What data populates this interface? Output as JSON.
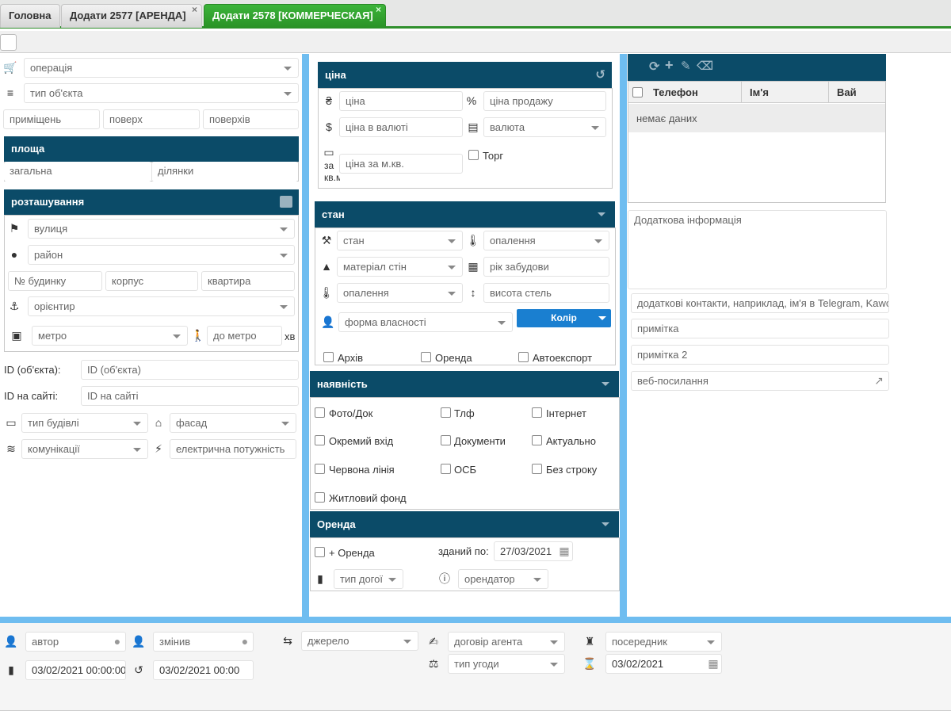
{
  "tabs": [
    {
      "label": "Головна"
    },
    {
      "label": "Додати 2577 [АРЕНДА]"
    },
    {
      "label": "Додати 2578 [КОММЕРЧЕСКАЯ]"
    }
  ],
  "tab_close": "×",
  "left": {
    "operation": "операція",
    "object_type": "тип об'єкта",
    "rooms": "приміщень",
    "floor": "поверх",
    "floors": "поверхів",
    "area_header": "площа",
    "area_total": "загальна",
    "area_plot": "ділянки",
    "location_header": "розташування",
    "street": "вулиця",
    "district": "район",
    "house_no": "№ будинку",
    "building": "корпус",
    "apartment": "квартира",
    "landmark": "орієнтир",
    "metro": "метро",
    "to_metro": "до метро",
    "minutes": "хв",
    "id_object_label": "ID (об'єкта):",
    "id_object_ph": "ID (об'єкта)",
    "id_site_label": "ID на сайті:",
    "id_site_ph": "ID на сайті",
    "building_type": "тип будівлі",
    "facade": "фасад",
    "communications": "комунікації",
    "power": "електрична потужність"
  },
  "price": {
    "header": "ціна",
    "price": "ціна",
    "sale_price": "ціна продажу",
    "price_currency": "ціна в валюті",
    "currency": "валюта",
    "per_sqm_label": "за кв.м",
    "per_sqm": "ціна за м.кв.",
    "bargain": "Торг"
  },
  "state": {
    "header": "стан",
    "state": "стан",
    "heating": "опалення",
    "wall_material": "матеріал стін",
    "year_built": "рік забудови",
    "heating2": "опалення",
    "ceiling_height": "висота стель",
    "ownership": "форма власності",
    "color_btn": "Колір",
    "archive": "Архів",
    "rent": "Оренда",
    "autoexport": "Автоекспорт"
  },
  "availability": {
    "header": "наявність",
    "items": [
      "Фото/Док",
      "Тлф",
      "Інтернет",
      "Окремий вхід",
      "Документи",
      "Актуально",
      "Червона лінія",
      "ОСБ",
      "Без строку",
      "Житловий фонд"
    ]
  },
  "rent": {
    "header": "Оренда",
    "plus_rent": "+ Оренда",
    "rented_until_label": "зданий по:",
    "rented_until": "27/03/2021",
    "contract_type": "тип догої",
    "tenant": "орендатор"
  },
  "contacts": {
    "columns": [
      "Телефон",
      "Ім'я",
      "Вай"
    ],
    "empty": "немає даних",
    "additional_info": "Додаткова інформація",
    "extra_contacts": "додаткові контакти, наприклад, ім'я в Telegram, Kawc",
    "note": "примітка",
    "note2": "примітка 2",
    "web_link": "веб-посилання"
  },
  "footer": {
    "author": "автор",
    "changed_by": "змінив",
    "source": "джерело",
    "agent_contract": "договір агента",
    "intermediary": "посередник",
    "created": "03/02/2021 00:00:00",
    "changed": "03/02/2021 00:00",
    "deal_type": "тип угоди",
    "date": "03/02/2021"
  },
  "colors": {
    "header": "#0b4b68",
    "tab_active": "#2f9a2b",
    "blue_divider": "#6fbdf0",
    "color_button": "#1a7fd0"
  }
}
